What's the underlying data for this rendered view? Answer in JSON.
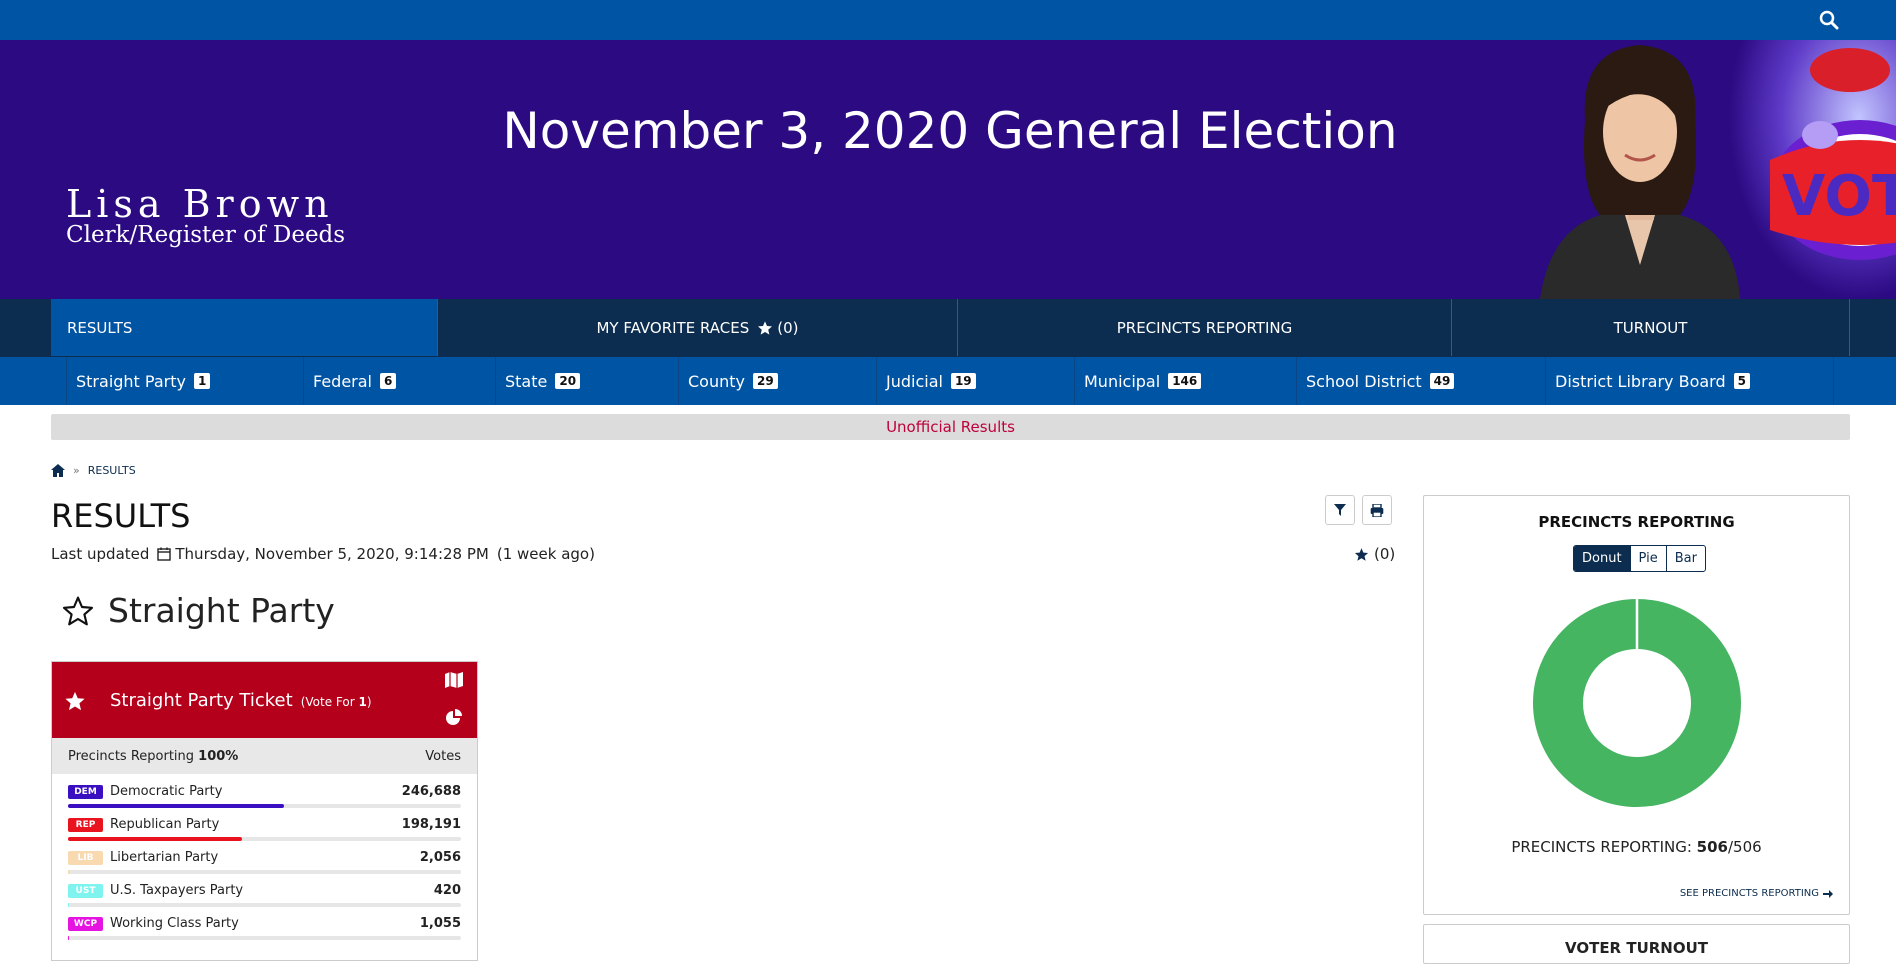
{
  "banner": {
    "title": "November 3, 2020 General Election",
    "clerk_name": "Lisa Brown",
    "clerk_title": "Clerk/Register of Deeds",
    "vote_text": "VOTE"
  },
  "main_nav": [
    {
      "label": "RESULTS"
    },
    {
      "label": "MY FAVORITE RACES",
      "count": "(0)"
    },
    {
      "label": "PRECINCTS REPORTING"
    },
    {
      "label": "TURNOUT"
    }
  ],
  "sub_nav": [
    {
      "label": "Straight Party",
      "badge": "1"
    },
    {
      "label": "Federal",
      "badge": "6"
    },
    {
      "label": "State",
      "badge": "20"
    },
    {
      "label": "County",
      "badge": "29"
    },
    {
      "label": "Judicial",
      "badge": "19"
    },
    {
      "label": "Municipal",
      "badge": "146"
    },
    {
      "label": "School District",
      "badge": "49"
    },
    {
      "label": "District Library Board",
      "badge": "5"
    }
  ],
  "notice": "Unofficial Results",
  "breadcrumb": {
    "current": "RESULTS"
  },
  "page": {
    "title": "RESULTS",
    "updated_label": "Last updated",
    "updated_value": "Thursday, November 5, 2020, 9:14:28 PM",
    "updated_ago": "(1 week ago)",
    "fav_count": "(0)"
  },
  "section": {
    "title": "Straight Party"
  },
  "race": {
    "name": "Straight Party Ticket",
    "vote_for_prefix": "(Vote For ",
    "vote_for_number": "1",
    "vote_for_suffix": ")",
    "precincts_label": "Precincts Reporting",
    "precincts_value": "100%",
    "votes_header": "Votes",
    "candidates": [
      {
        "tag": "DEM",
        "name": "Democratic Party",
        "votes": "246,688",
        "share": 0.55,
        "color": "#3a0fc2"
      },
      {
        "tag": "REP",
        "name": "Republican Party",
        "votes": "198,191",
        "share": 0.442,
        "color": "#e8131f"
      },
      {
        "tag": "LIB",
        "name": "Libertarian Party",
        "votes": "2,056",
        "share": 0.005,
        "color": "#f8d9b0"
      },
      {
        "tag": "UST",
        "name": "U.S. Taxpayers Party",
        "votes": "420",
        "share": 0.001,
        "color": "#7ff4ef"
      },
      {
        "tag": "WCP",
        "name": "Working Class Party",
        "votes": "1,055",
        "share": 0.002,
        "color": "#e614e0"
      }
    ]
  },
  "precincts_panel": {
    "title": "PRECINCTS REPORTING",
    "chart_types": [
      "Donut",
      "Pie",
      "Bar"
    ],
    "reporting_label": "PRECINCTS REPORTING:",
    "reporting_value": "506",
    "reporting_total": "/506",
    "link": "SEE PRECINCTS REPORTING",
    "reported_fraction": 1.0,
    "color": "#46b562"
  },
  "turnout_panel": {
    "title": "VOTER TURNOUT"
  }
}
